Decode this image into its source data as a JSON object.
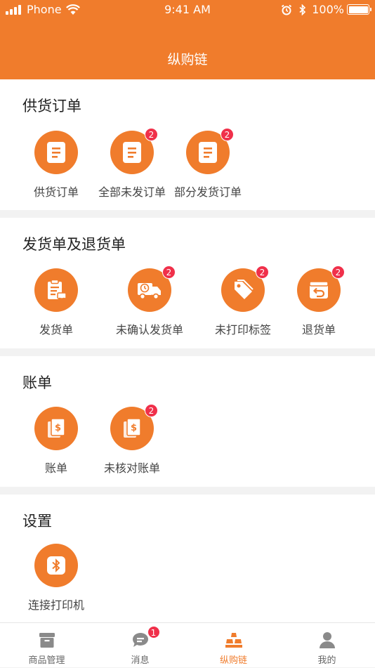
{
  "status_bar": {
    "carrier": "Phone",
    "time": "9:41 AM",
    "battery": "100%"
  },
  "header": {
    "title": "纵购链"
  },
  "sections": {
    "supply": {
      "title": "供货订单",
      "items": [
        {
          "label": "供货订单",
          "badge": ""
        },
        {
          "label": "全部未发订单",
          "badge": "2"
        },
        {
          "label": "部分发货订单",
          "badge": "2"
        }
      ]
    },
    "shipping": {
      "title": "发货单及退货单",
      "items": [
        {
          "label": "发货单",
          "badge": ""
        },
        {
          "label": "未确认发货单",
          "badge": "2"
        },
        {
          "label": "未打印标签",
          "badge": "2"
        },
        {
          "label": "退货单",
          "badge": "2"
        }
      ]
    },
    "bill": {
      "title": "账单",
      "items": [
        {
          "label": "账单",
          "badge": ""
        },
        {
          "label": "未核对账单",
          "badge": "2"
        }
      ]
    },
    "settings": {
      "title": "设置",
      "items": [
        {
          "label": "连接打印机",
          "badge": ""
        }
      ]
    }
  },
  "tabbar": {
    "tabs": [
      {
        "label": "商品管理",
        "icon": "box-icon",
        "badge": ""
      },
      {
        "label": "消息",
        "icon": "chat-icon",
        "badge": "1"
      },
      {
        "label": "纵购链",
        "icon": "stack-icon",
        "badge": "",
        "active": true
      },
      {
        "label": "我的",
        "icon": "person-icon",
        "badge": ""
      }
    ]
  },
  "colors": {
    "brand": "#f07c2c",
    "badge": "#f0304a"
  }
}
